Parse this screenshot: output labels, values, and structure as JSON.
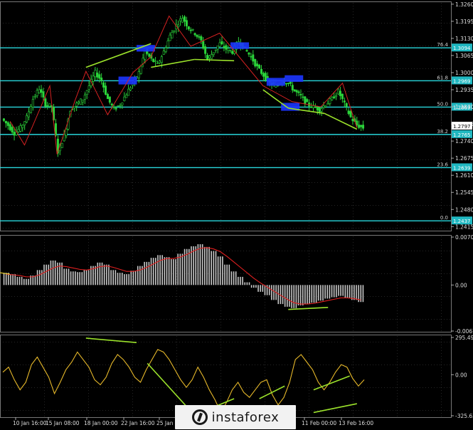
{
  "chart_data": [
    {
      "panel": "price",
      "type": "candlestick",
      "ylim": [
        1.2405,
        1.3265
      ],
      "y_ticks": [
        "1.3260",
        "1.3195",
        "1.3130",
        "1.3065",
        "1.3000",
        "1.2935",
        "1.2870",
        "1.2805",
        "1.2740",
        "1.2675",
        "1.2610",
        "1.2545",
        "1.2480",
        "1.2415"
      ],
      "x_ticks": [
        "10 Jan 16:00",
        "15 Jan 08:00",
        "18 Jan 00:00",
        "22 Jan 16:00",
        "25 Jan",
        "11 Feb 00:00",
        "13 Feb 16:00"
      ],
      "fib_levels": [
        {
          "pct": "76.4",
          "value": "1.3094",
          "y": 1.3094
        },
        {
          "pct": "61.8",
          "value": "1.2969",
          "y": 1.2969
        },
        {
          "pct": "50.0",
          "value": "1.2869",
          "y": 1.2869
        },
        {
          "pct": "38.2",
          "value": "1.2765",
          "y": 1.2765
        },
        {
          "pct": "23.6",
          "value": "1.2639",
          "y": 1.2639
        },
        {
          "pct": "0.0",
          "value": "1.2437",
          "y": 1.2437
        }
      ],
      "current_price": "1.2797",
      "close_path": [
        1.2825,
        1.28,
        1.277,
        1.279,
        1.283,
        1.29,
        1.294,
        1.288,
        1.287,
        1.27,
        1.276,
        1.286,
        1.288,
        1.29,
        1.295,
        1.3,
        1.297,
        1.29,
        1.286,
        1.288,
        1.292,
        1.296,
        1.3,
        1.308,
        1.305,
        1.303,
        1.308,
        1.314,
        1.318,
        1.321,
        1.317,
        1.315,
        1.312,
        1.305,
        1.308,
        1.311,
        1.309,
        1.308,
        1.312,
        1.309,
        1.306,
        1.302,
        1.299,
        1.296,
        1.295,
        1.297,
        1.296,
        1.293,
        1.291,
        1.288,
        1.287,
        1.286,
        1.288,
        1.29,
        1.293,
        1.288,
        1.283,
        1.28,
        1.279
      ]
    },
    {
      "panel": "macd",
      "type": "histogram",
      "ylim": [
        -0.00677,
        0.00705
      ],
      "y_ticks": [
        "0.00705",
        "0.00",
        "-0.00677"
      ],
      "histogram": [
        0.0018,
        0.0016,
        0.0012,
        0.0009,
        0.0014,
        0.0022,
        0.003,
        0.0036,
        0.0033,
        0.0024,
        0.002,
        0.0019,
        0.0022,
        0.0028,
        0.0033,
        0.003,
        0.0022,
        0.0018,
        0.0016,
        0.0021,
        0.0028,
        0.0034,
        0.004,
        0.0044,
        0.0041,
        0.0038,
        0.0046,
        0.0053,
        0.0057,
        0.006,
        0.0056,
        0.005,
        0.0042,
        0.003,
        0.002,
        0.0012,
        0.0004,
        -0.0004,
        -0.001,
        -0.0015,
        -0.0022,
        -0.0028,
        -0.0032,
        -0.0034,
        -0.003,
        -0.0028,
        -0.0026,
        -0.0023,
        -0.002,
        -0.0018,
        -0.0016,
        -0.0019,
        -0.0022,
        -0.0025
      ],
      "signal": [
        0.0016,
        0.0015,
        0.0014,
        0.0012,
        0.0012,
        0.0015,
        0.002,
        0.0025,
        0.0028,
        0.0027,
        0.0025,
        0.0023,
        0.0022,
        0.0024,
        0.0027,
        0.0028,
        0.0026,
        0.0023,
        0.002,
        0.002,
        0.0022,
        0.0026,
        0.0031,
        0.0036,
        0.0039,
        0.0039,
        0.0041,
        0.0045,
        0.005,
        0.0054,
        0.0055,
        0.0053,
        0.0049,
        0.0042,
        0.0034,
        0.0026,
        0.0018,
        0.001,
        0.0003,
        -0.0003,
        -0.0009,
        -0.0015,
        -0.0021,
        -0.0026,
        -0.0028,
        -0.0028,
        -0.0027,
        -0.0025,
        -0.0023,
        -0.0021,
        -0.0019,
        -0.0019,
        -0.002,
        -0.0022
      ]
    },
    {
      "panel": "cci",
      "type": "line",
      "ylim": [
        -325.6303,
        295.4989
      ],
      "y_ticks": [
        "295.4989",
        "0.00",
        "-325.6303"
      ],
      "values": [
        20,
        60,
        -40,
        -120,
        -60,
        80,
        140,
        60,
        -20,
        -150,
        -60,
        40,
        100,
        180,
        120,
        60,
        -40,
        -80,
        -20,
        90,
        160,
        120,
        60,
        -20,
        -60,
        40,
        120,
        200,
        180,
        120,
        40,
        -40,
        -100,
        -40,
        60,
        -20,
        -120,
        -200,
        -300,
        -220,
        -120,
        -60,
        -140,
        -180,
        -120,
        -60,
        -40,
        -160,
        -240,
        -180,
        -60,
        120,
        160,
        100,
        40,
        -60,
        -120,
        -60,
        20,
        80,
        60,
        -30,
        -90,
        -40
      ]
    }
  ]
}
